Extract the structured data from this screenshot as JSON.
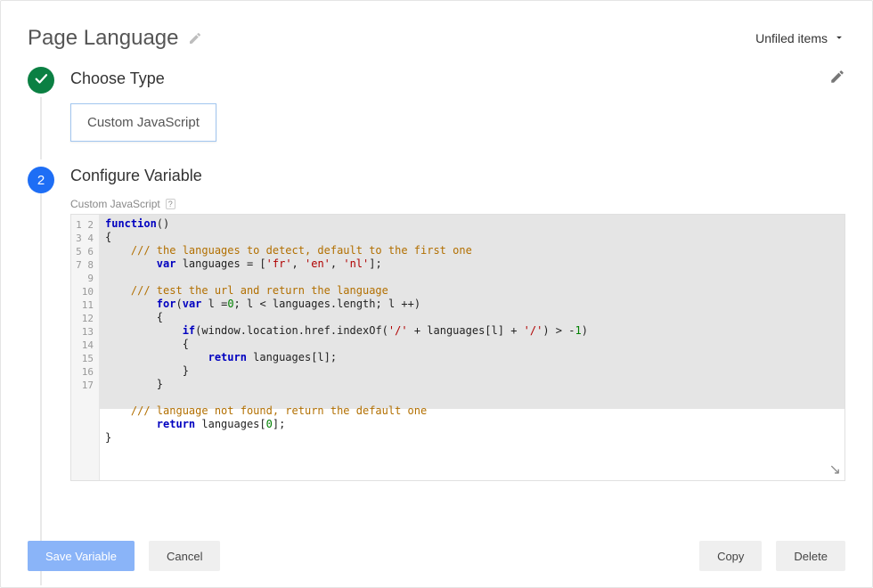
{
  "header": {
    "title": "Page Language",
    "unfiled_label": "Unfiled items"
  },
  "step1": {
    "title": "Choose Type",
    "chip": "Custom JavaScript"
  },
  "step2": {
    "number": "2",
    "title": "Configure Variable",
    "field_label": "Custom JavaScript",
    "help_symbol": "?",
    "line_count": 17,
    "code": {
      "l1_kw": "function",
      "l1_rest": "()",
      "l2": "{",
      "l3_com": "    /// the languages to detect, default to the first one",
      "l4_a": "        ",
      "l4_kw": "var",
      "l4_b": " languages = [",
      "l4_s1": "'fr'",
      "l4_c": ", ",
      "l4_s2": "'en'",
      "l4_d": ", ",
      "l4_s3": "'nl'",
      "l4_e": "];",
      "l5": "",
      "l6_com": "    /// test the url and return the language",
      "l7_a": "        ",
      "l7_kw": "for",
      "l7_b": "(",
      "l7_kw2": "var",
      "l7_c": " l =",
      "l7_n0": "0",
      "l7_d": "; l < languages.length; l ++)",
      "l8": "        {",
      "l9_a": "            ",
      "l9_kw": "if",
      "l9_b": "(window.location.href.indexOf(",
      "l9_s1": "'/'",
      "l9_c": " + languages[l] + ",
      "l9_s2": "'/'",
      "l9_d": ") > -",
      "l9_n": "1",
      "l9_e": ")",
      "l10": "            {",
      "l11_a": "                ",
      "l11_kw": "return",
      "l11_b": " languages[l];",
      "l12": "            }",
      "l13": "        }",
      "l14": "",
      "l15_com": "    /// language not found, return the default one",
      "l16_a": "        ",
      "l16_kw": "return",
      "l16_b": " languages[",
      "l16_n": "0",
      "l16_c": "];",
      "l17": "}"
    }
  },
  "footer": {
    "save": "Save Variable",
    "cancel": "Cancel",
    "copy": "Copy",
    "delete": "Delete"
  }
}
